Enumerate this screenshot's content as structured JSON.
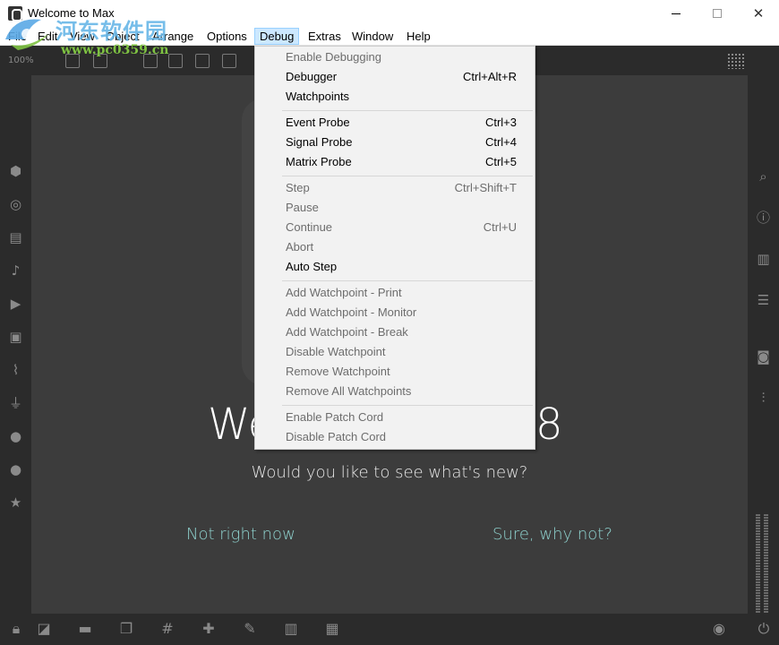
{
  "window": {
    "title": "Welcome to Max",
    "controls": {
      "minimize": "minimize",
      "maximize": "maximize",
      "close": "✕"
    }
  },
  "watermark": {
    "line1": "河东软件园",
    "line2": "www.pc0359.cn"
  },
  "menubar": {
    "items": [
      "File",
      "Edit",
      "View",
      "Object",
      "Arrange",
      "Options",
      "Debug",
      "Extras",
      "Window",
      "Help"
    ],
    "active": "Debug"
  },
  "toolbar": {
    "zoom": "100%"
  },
  "debug_menu": {
    "items": [
      {
        "label": "Enable Debugging",
        "shortcut": "",
        "enabled": false
      },
      {
        "label": "Debugger",
        "shortcut": "Ctrl+Alt+R",
        "enabled": true
      },
      {
        "label": "Watchpoints",
        "shortcut": "",
        "enabled": true
      },
      {
        "label": "Event Probe",
        "shortcut": "Ctrl+3",
        "enabled": true
      },
      {
        "label": "Signal Probe",
        "shortcut": "Ctrl+4",
        "enabled": true
      },
      {
        "label": "Matrix Probe",
        "shortcut": "Ctrl+5",
        "enabled": true
      },
      {
        "label": "Step",
        "shortcut": "Ctrl+Shift+T",
        "enabled": false
      },
      {
        "label": "Pause",
        "shortcut": "",
        "enabled": false
      },
      {
        "label": "Continue",
        "shortcut": "Ctrl+U",
        "enabled": false
      },
      {
        "label": "Abort",
        "shortcut": "",
        "enabled": false
      },
      {
        "label": "Auto Step",
        "shortcut": "",
        "enabled": true
      },
      {
        "label": "Add Watchpoint - Print",
        "shortcut": "",
        "enabled": false
      },
      {
        "label": "Add Watchpoint - Monitor",
        "shortcut": "",
        "enabled": false
      },
      {
        "label": "Add Watchpoint - Break",
        "shortcut": "",
        "enabled": false
      },
      {
        "label": "Disable Watchpoint",
        "shortcut": "",
        "enabled": false
      },
      {
        "label": "Remove Watchpoint",
        "shortcut": "",
        "enabled": false
      },
      {
        "label": "Remove All Watchpoints",
        "shortcut": "",
        "enabled": false
      },
      {
        "label": "Enable Patch Cord",
        "shortcut": "",
        "enabled": false
      },
      {
        "label": "Disable Patch Cord",
        "shortcut": "",
        "enabled": false
      }
    ]
  },
  "welcome": {
    "heading_left": "We",
    "heading_right": "8",
    "question": "Would you like to see what's new?",
    "decline": "Not right now",
    "accept": "Sure, why not?"
  },
  "colors": {
    "menu_highlight": "#cce8ff",
    "accent_link": "#8fd3cf",
    "patcher_bg": "#3c3c3c",
    "chrome_bg": "#2b2b2b"
  },
  "icons": {
    "left_sidebar": [
      "package-icon",
      "target-icon",
      "film-icon",
      "music-note-icon",
      "media-icon",
      "image-icon",
      "paperclip-icon",
      "plug-icon",
      "v-badge-icon",
      "b-badge-icon",
      "star-icon"
    ],
    "right_sidebar": [
      "search-icon",
      "info-icon",
      "book-icon",
      "list-icon",
      "camera-icon",
      "mixer-icon"
    ],
    "bottom_bar": [
      "lock-icon",
      "edit-mode-icon",
      "presentation-icon",
      "layers-icon",
      "grid-icon",
      "plus-object-icon",
      "wrench-icon",
      "piano-icon",
      "keyboard-icon",
      "play-circle-icon",
      "power-icon"
    ]
  }
}
